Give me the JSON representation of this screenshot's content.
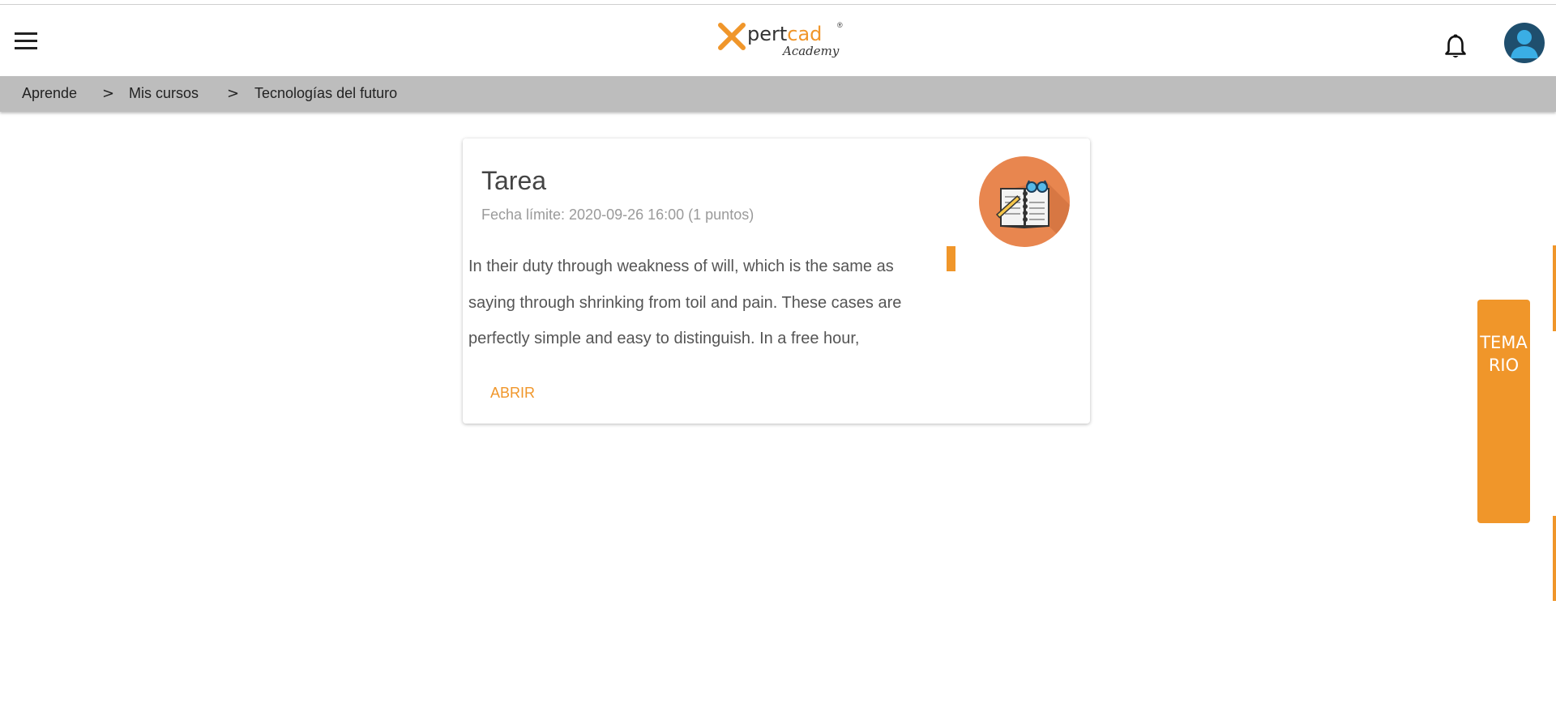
{
  "header": {
    "menu_icon": "hamburger-menu-icon",
    "logo": {
      "text_prefix": "x",
      "text_main": "pert",
      "text_accent": "cad",
      "registered": "®",
      "subtitle": "Academy"
    },
    "notification_icon": "bell-icon",
    "avatar_icon": "user-avatar-icon"
  },
  "breadcrumb": {
    "items": [
      "Aprende",
      "Mis cursos",
      "Tecnologías del futuro"
    ],
    "separator": ">"
  },
  "card": {
    "title": "Tarea",
    "subtitle": "Fecha límite: 2020-09-26 16:00 (1 puntos)",
    "body": "In their duty through weakness of will, which is the same as saying through shrinking from toil and pain. These cases are perfectly simple and easy to distinguish. In a free hour,",
    "action_label": "ABRIR",
    "icon": "notebook-with-pencil-and-glasses-icon"
  },
  "side_tab": {
    "label": "TEMARIO"
  },
  "colors": {
    "accent": "#f0962a",
    "breadcrumb_bg": "#bdbdbd",
    "icon_circle": "#e8864f",
    "avatar_bg": "#1f4f6e"
  }
}
